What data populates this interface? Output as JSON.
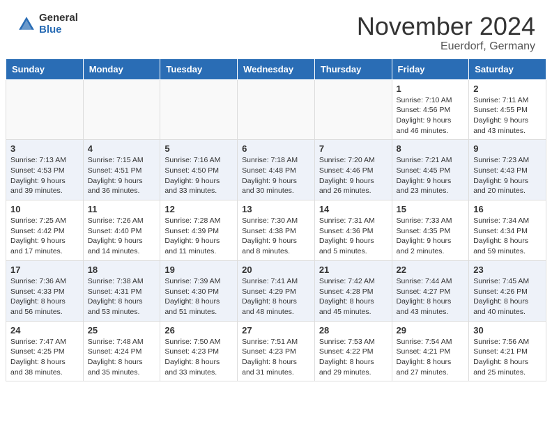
{
  "logo": {
    "general": "General",
    "blue": "Blue"
  },
  "header": {
    "month": "November 2024",
    "location": "Euerdorf, Germany"
  },
  "weekdays": [
    "Sunday",
    "Monday",
    "Tuesday",
    "Wednesday",
    "Thursday",
    "Friday",
    "Saturday"
  ],
  "weeks": [
    [
      {
        "day": "",
        "info": ""
      },
      {
        "day": "",
        "info": ""
      },
      {
        "day": "",
        "info": ""
      },
      {
        "day": "",
        "info": ""
      },
      {
        "day": "",
        "info": ""
      },
      {
        "day": "1",
        "info": "Sunrise: 7:10 AM\nSunset: 4:56 PM\nDaylight: 9 hours and 46 minutes."
      },
      {
        "day": "2",
        "info": "Sunrise: 7:11 AM\nSunset: 4:55 PM\nDaylight: 9 hours and 43 minutes."
      }
    ],
    [
      {
        "day": "3",
        "info": "Sunrise: 7:13 AM\nSunset: 4:53 PM\nDaylight: 9 hours and 39 minutes."
      },
      {
        "day": "4",
        "info": "Sunrise: 7:15 AM\nSunset: 4:51 PM\nDaylight: 9 hours and 36 minutes."
      },
      {
        "day": "5",
        "info": "Sunrise: 7:16 AM\nSunset: 4:50 PM\nDaylight: 9 hours and 33 minutes."
      },
      {
        "day": "6",
        "info": "Sunrise: 7:18 AM\nSunset: 4:48 PM\nDaylight: 9 hours and 30 minutes."
      },
      {
        "day": "7",
        "info": "Sunrise: 7:20 AM\nSunset: 4:46 PM\nDaylight: 9 hours and 26 minutes."
      },
      {
        "day": "8",
        "info": "Sunrise: 7:21 AM\nSunset: 4:45 PM\nDaylight: 9 hours and 23 minutes."
      },
      {
        "day": "9",
        "info": "Sunrise: 7:23 AM\nSunset: 4:43 PM\nDaylight: 9 hours and 20 minutes."
      }
    ],
    [
      {
        "day": "10",
        "info": "Sunrise: 7:25 AM\nSunset: 4:42 PM\nDaylight: 9 hours and 17 minutes."
      },
      {
        "day": "11",
        "info": "Sunrise: 7:26 AM\nSunset: 4:40 PM\nDaylight: 9 hours and 14 minutes."
      },
      {
        "day": "12",
        "info": "Sunrise: 7:28 AM\nSunset: 4:39 PM\nDaylight: 9 hours and 11 minutes."
      },
      {
        "day": "13",
        "info": "Sunrise: 7:30 AM\nSunset: 4:38 PM\nDaylight: 9 hours and 8 minutes."
      },
      {
        "day": "14",
        "info": "Sunrise: 7:31 AM\nSunset: 4:36 PM\nDaylight: 9 hours and 5 minutes."
      },
      {
        "day": "15",
        "info": "Sunrise: 7:33 AM\nSunset: 4:35 PM\nDaylight: 9 hours and 2 minutes."
      },
      {
        "day": "16",
        "info": "Sunrise: 7:34 AM\nSunset: 4:34 PM\nDaylight: 8 hours and 59 minutes."
      }
    ],
    [
      {
        "day": "17",
        "info": "Sunrise: 7:36 AM\nSunset: 4:33 PM\nDaylight: 8 hours and 56 minutes."
      },
      {
        "day": "18",
        "info": "Sunrise: 7:38 AM\nSunset: 4:31 PM\nDaylight: 8 hours and 53 minutes."
      },
      {
        "day": "19",
        "info": "Sunrise: 7:39 AM\nSunset: 4:30 PM\nDaylight: 8 hours and 51 minutes."
      },
      {
        "day": "20",
        "info": "Sunrise: 7:41 AM\nSunset: 4:29 PM\nDaylight: 8 hours and 48 minutes."
      },
      {
        "day": "21",
        "info": "Sunrise: 7:42 AM\nSunset: 4:28 PM\nDaylight: 8 hours and 45 minutes."
      },
      {
        "day": "22",
        "info": "Sunrise: 7:44 AM\nSunset: 4:27 PM\nDaylight: 8 hours and 43 minutes."
      },
      {
        "day": "23",
        "info": "Sunrise: 7:45 AM\nSunset: 4:26 PM\nDaylight: 8 hours and 40 minutes."
      }
    ],
    [
      {
        "day": "24",
        "info": "Sunrise: 7:47 AM\nSunset: 4:25 PM\nDaylight: 8 hours and 38 minutes."
      },
      {
        "day": "25",
        "info": "Sunrise: 7:48 AM\nSunset: 4:24 PM\nDaylight: 8 hours and 35 minutes."
      },
      {
        "day": "26",
        "info": "Sunrise: 7:50 AM\nSunset: 4:23 PM\nDaylight: 8 hours and 33 minutes."
      },
      {
        "day": "27",
        "info": "Sunrise: 7:51 AM\nSunset: 4:23 PM\nDaylight: 8 hours and 31 minutes."
      },
      {
        "day": "28",
        "info": "Sunrise: 7:53 AM\nSunset: 4:22 PM\nDaylight: 8 hours and 29 minutes."
      },
      {
        "day": "29",
        "info": "Sunrise: 7:54 AM\nSunset: 4:21 PM\nDaylight: 8 hours and 27 minutes."
      },
      {
        "day": "30",
        "info": "Sunrise: 7:56 AM\nSunset: 4:21 PM\nDaylight: 8 hours and 25 minutes."
      }
    ]
  ]
}
